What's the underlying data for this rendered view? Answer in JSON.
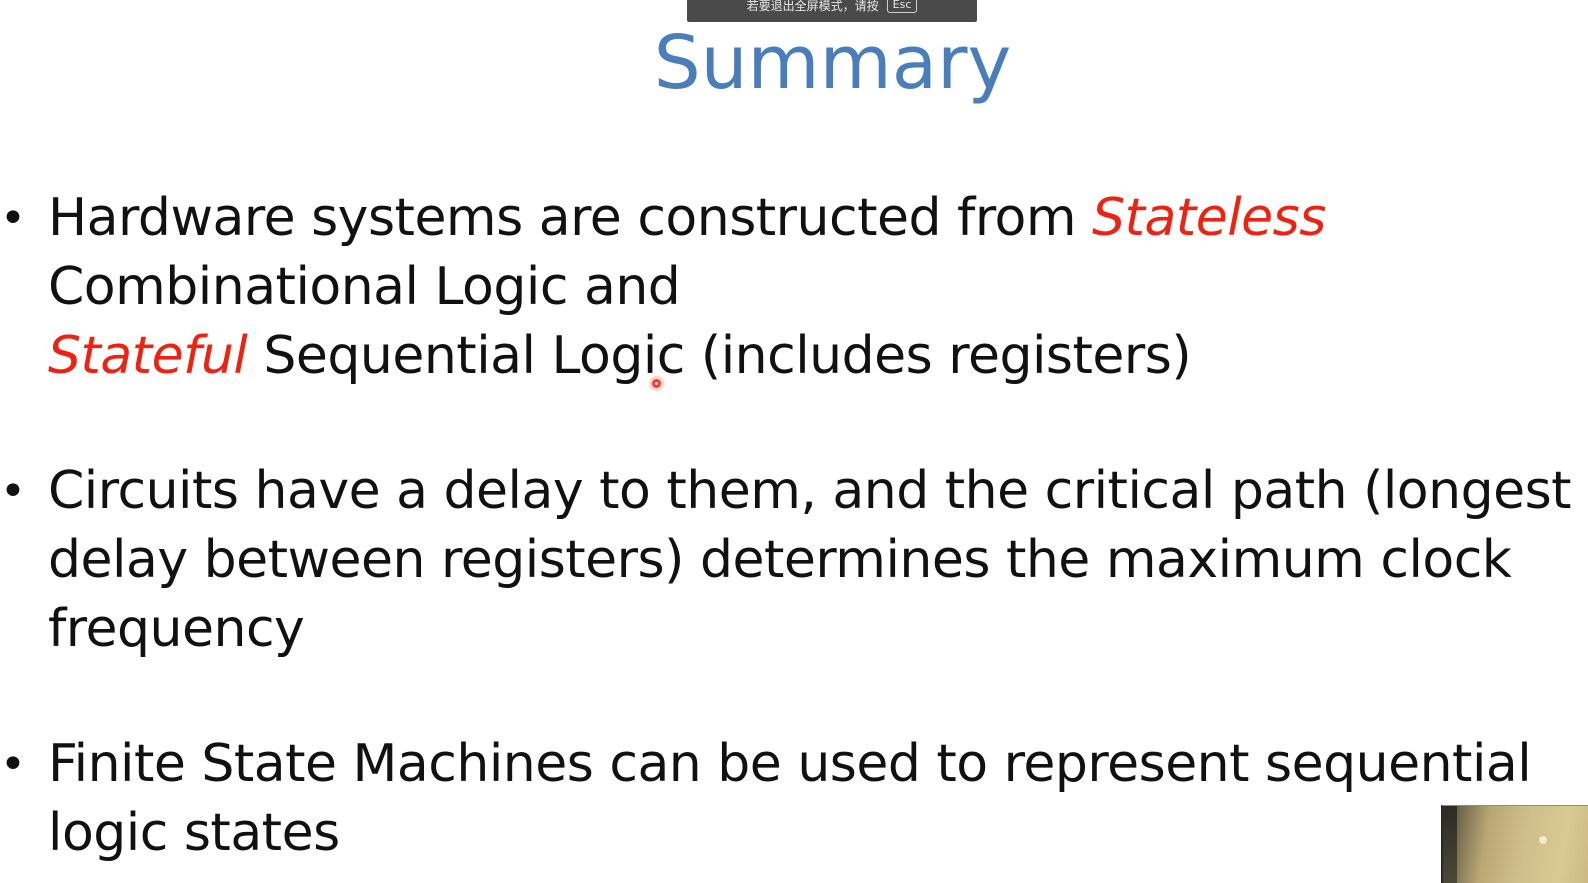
{
  "fullscreen_banner": {
    "text": "若要退出全屏模式，请按",
    "key": "Esc"
  },
  "slide": {
    "title": "Summary",
    "bullets": [
      {
        "lines": [
          [
            "Hardware systems are constructed from ",
            "Stateless"
          ],
          [
            "Combinational Logic and"
          ],
          [
            "Stateful",
            " Sequential Logic (includes registers)"
          ]
        ]
      },
      {
        "lines": [
          [
            "Circuits have a delay to them, and the critical path (longest"
          ],
          [
            "delay between registers) determines the maximum clock"
          ],
          [
            "frequency"
          ]
        ]
      },
      {
        "lines": [
          [
            "Finite State Machines can be used to represent sequential"
          ],
          [
            "logic states"
          ]
        ]
      }
    ],
    "bullet_symbol": "•"
  },
  "colors": {
    "title": "#4a7ebb",
    "emphasis": "#ee2211",
    "text": "#111111",
    "banner_bg": "#4a4a4a"
  },
  "icons": {
    "pointer": "laser-pointer-icon",
    "video": "webcam-thumbnail"
  }
}
